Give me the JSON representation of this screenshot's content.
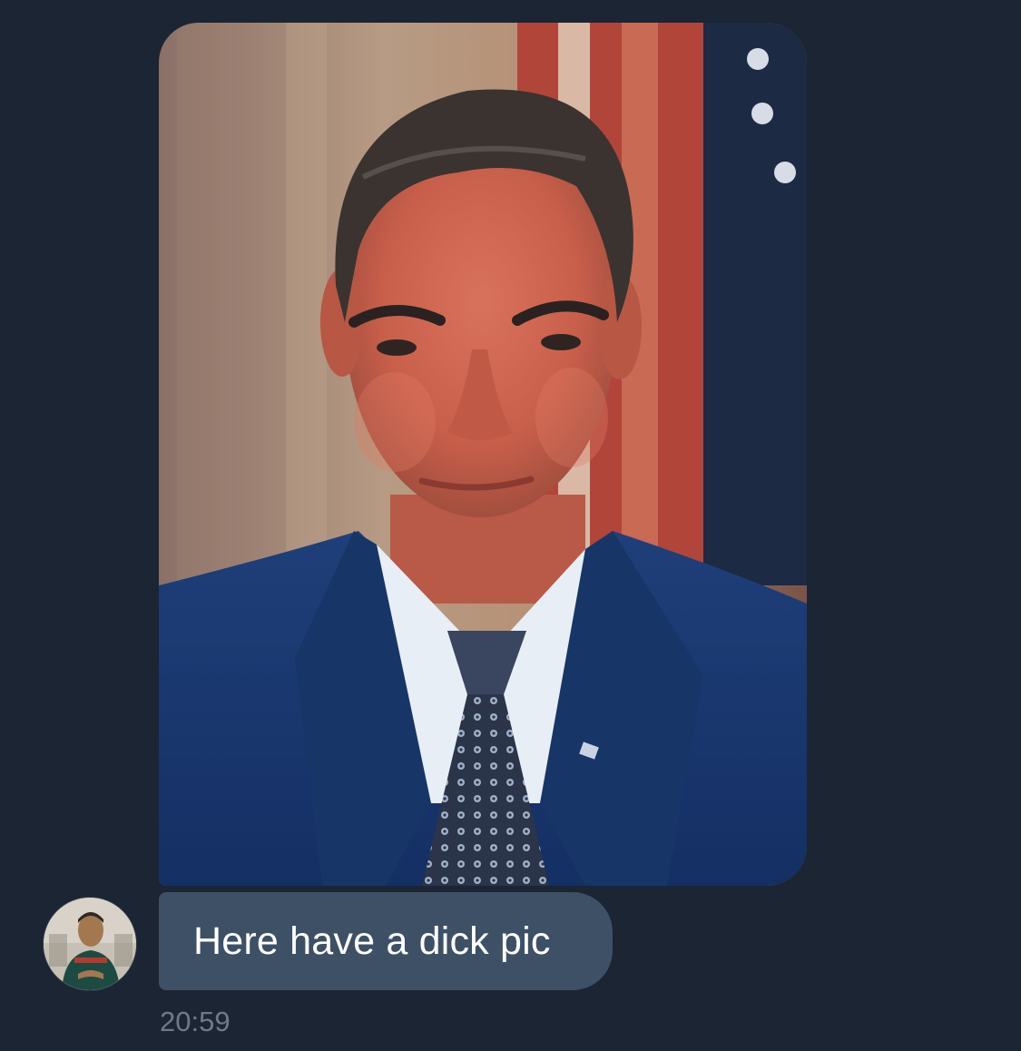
{
  "conversation": {
    "messages": [
      {
        "type": "image",
        "image_label": "portrait-photo"
      },
      {
        "type": "text",
        "text": "Here have a dick pic",
        "time": "20:59"
      }
    ]
  },
  "colors": {
    "background": "#1b2533",
    "bubble": "#3d5066",
    "message_text": "#ffffff",
    "timestamp": "#6e7a89"
  },
  "icons": {
    "sender_avatar": "avatar"
  }
}
